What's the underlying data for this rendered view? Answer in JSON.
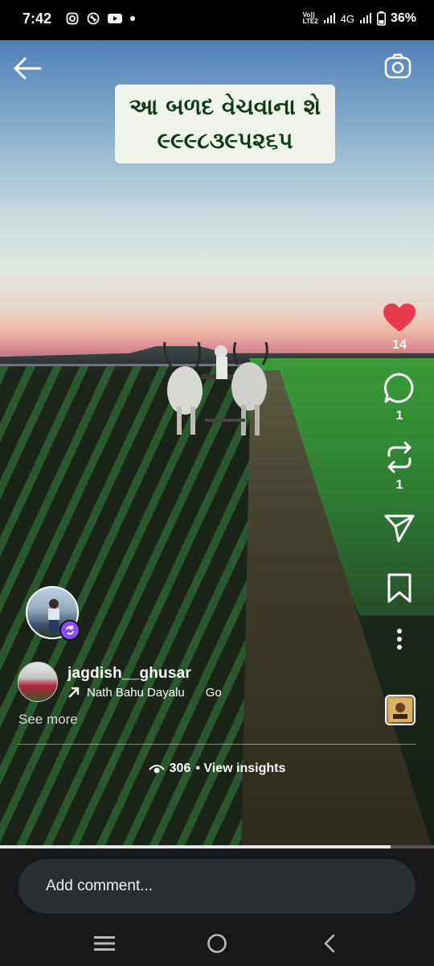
{
  "status_bar": {
    "time": "7:42",
    "network": "4G",
    "volte": "Vo))\nLTE2",
    "battery": "36%"
  },
  "video": {
    "overlay_text": [
      "આ બળદ વેચવાના શે",
      "૯૯૯૮૩૯પ૨૬પ"
    ]
  },
  "actions": {
    "like_count": "14",
    "comment_count": "1",
    "repost_count": "1",
    "liked_color": "#ed3a4a"
  },
  "post": {
    "username": "jagdish__ghusar",
    "audio_title": "Nath Bahu Dayalu",
    "audio_title_2": "Go",
    "see_more": "See more",
    "views": "306",
    "insights_label": "• View insights"
  },
  "comment": {
    "placeholder": "Add comment..."
  },
  "progress": {
    "played_fraction": 0.9
  },
  "icons": [
    "back-arrow-icon",
    "camera-icon",
    "heart-icon",
    "comment-icon",
    "repost-icon",
    "send-icon",
    "bookmark-icon",
    "more-icon",
    "eye-icon",
    "music-arrow-icon",
    "recents-icon",
    "home-icon",
    "back-nav-icon"
  ]
}
